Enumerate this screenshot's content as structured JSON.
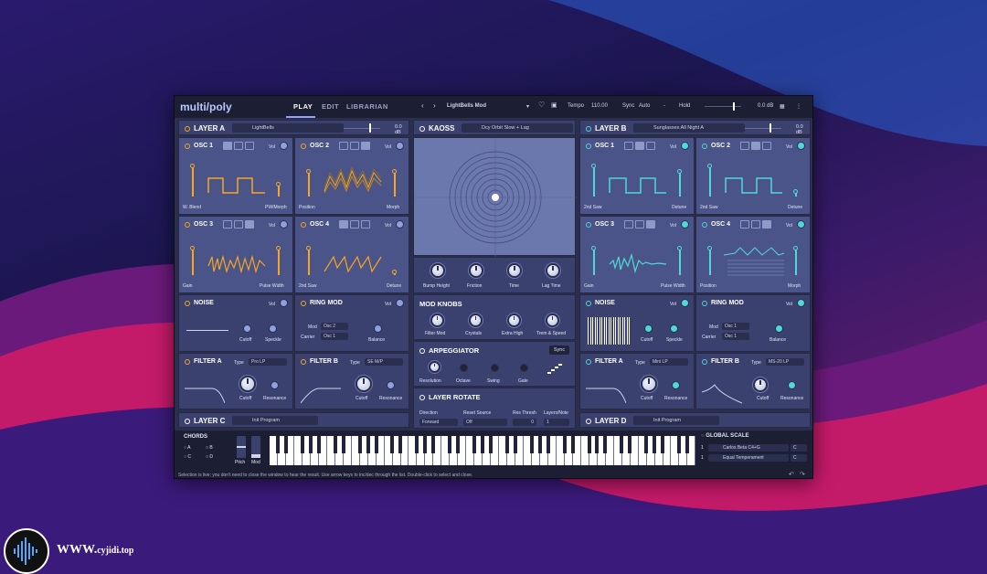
{
  "app": {
    "logo": "multi/poly",
    "tabs": [
      "PLAY",
      "EDIT",
      "LIBRARIAN"
    ],
    "preset_name": "LightBells Mod",
    "tempo_label": "Tempo",
    "tempo": "110.00",
    "sync_label": "Sync",
    "sync": "Auto",
    "hold": "Hold",
    "master_db": "0.0 dB"
  },
  "layer_a": {
    "title": "LAYER A",
    "preset": "LightBells",
    "db": "0.0 dB"
  },
  "layer_b": {
    "title": "LAYER B",
    "preset": "Sunglasses All Night A",
    "db": "0.0 dB"
  },
  "layer_c": {
    "title": "LAYER C",
    "preset": "Init Program"
  },
  "layer_d": {
    "title": "LAYER D",
    "preset": "Init Program"
  },
  "kaoss": {
    "title": "KAOSS",
    "preset": "Dcy Orbit Slow + Lag",
    "knobs": [
      "Bump Height",
      "Friction",
      "Time",
      "Lag Time"
    ]
  },
  "mod_knobs": {
    "title": "MOD KNOBS",
    "knobs": [
      "Filter Mod",
      "Crystals",
      "Extra High",
      "Trem & Speed"
    ]
  },
  "arp": {
    "title": "ARPEGGIATOR",
    "sync": "Sync",
    "knobs": [
      "Resolution",
      "Octave",
      "Swing",
      "Gate"
    ]
  },
  "rotate": {
    "title": "LAYER ROTATE",
    "labels": [
      "Direction",
      "Reset Source",
      "Res Thresh",
      "Layers/Note"
    ],
    "values": [
      "Forward",
      "Off",
      "0",
      "1"
    ]
  },
  "osc": {
    "osc1": "OSC 1",
    "osc2": "OSC 2",
    "osc3": "OSC 3",
    "osc4": "OSC 4",
    "vol": "Vol"
  },
  "osc_labels_a": {
    "o1l": "W. Blend",
    "o1r": "PW/Morph",
    "o2l": "Position",
    "o2r": "Morph",
    "o3l": "Gain",
    "o3r": "Pulse Width",
    "o4l": "2nd Saw",
    "o4r": "Detune"
  },
  "osc_labels_b": {
    "o1l": "2nd Saw",
    "o1r": "Detune",
    "o2l": "2nd Saw",
    "o2r": "Detune",
    "o3l": "Gain",
    "o3r": "Pulse Width",
    "o4l": "Position",
    "o4r": "Morph"
  },
  "noise": {
    "title": "NOISE",
    "k1": "Cutoff",
    "k2": "Speckle"
  },
  "ringmod": {
    "title": "RING MOD",
    "mod": "Mod",
    "carrier": "Carrier",
    "mod_val_a": "Osc 2",
    "car_val_a": "Osc 1",
    "mod_val_b": "Osc 1",
    "car_val_b": "Osc 1",
    "balance": "Balance"
  },
  "filter_a": {
    "title": "FILTER A",
    "type": "Type",
    "type_val_a": "Pro LP",
    "type_val_b": "Mini LP",
    "cutoff": "Cutoff",
    "res": "Resonance"
  },
  "filter_b": {
    "title": "FILTER B",
    "type_val_a": "SE M/P",
    "type_val_b": "MS-20 LP"
  },
  "chords": {
    "title": "CHORDS",
    "items": [
      "A",
      "B",
      "C",
      "D"
    ],
    "pitch": "Pitch",
    "mod": "Mod"
  },
  "global_scale": {
    "title": "GLOBAL SCALE",
    "scale": "Carlos Beta C4+G",
    "tuning": "Equal Temperament",
    "key": "C",
    "key2": "C",
    "n1": "1",
    "n2": "1"
  },
  "status": "Selection is live; you don't need to close the window to hear the result. Use arrow keys to inc/dec through the list. Double-click to select and close.",
  "watermark": {
    "www": "WWW.",
    "site": "cyjidi.top"
  },
  "colors": {
    "accent_a": "#f5a623",
    "accent_b": "#4fd8d8",
    "panel": "#4b5488"
  }
}
